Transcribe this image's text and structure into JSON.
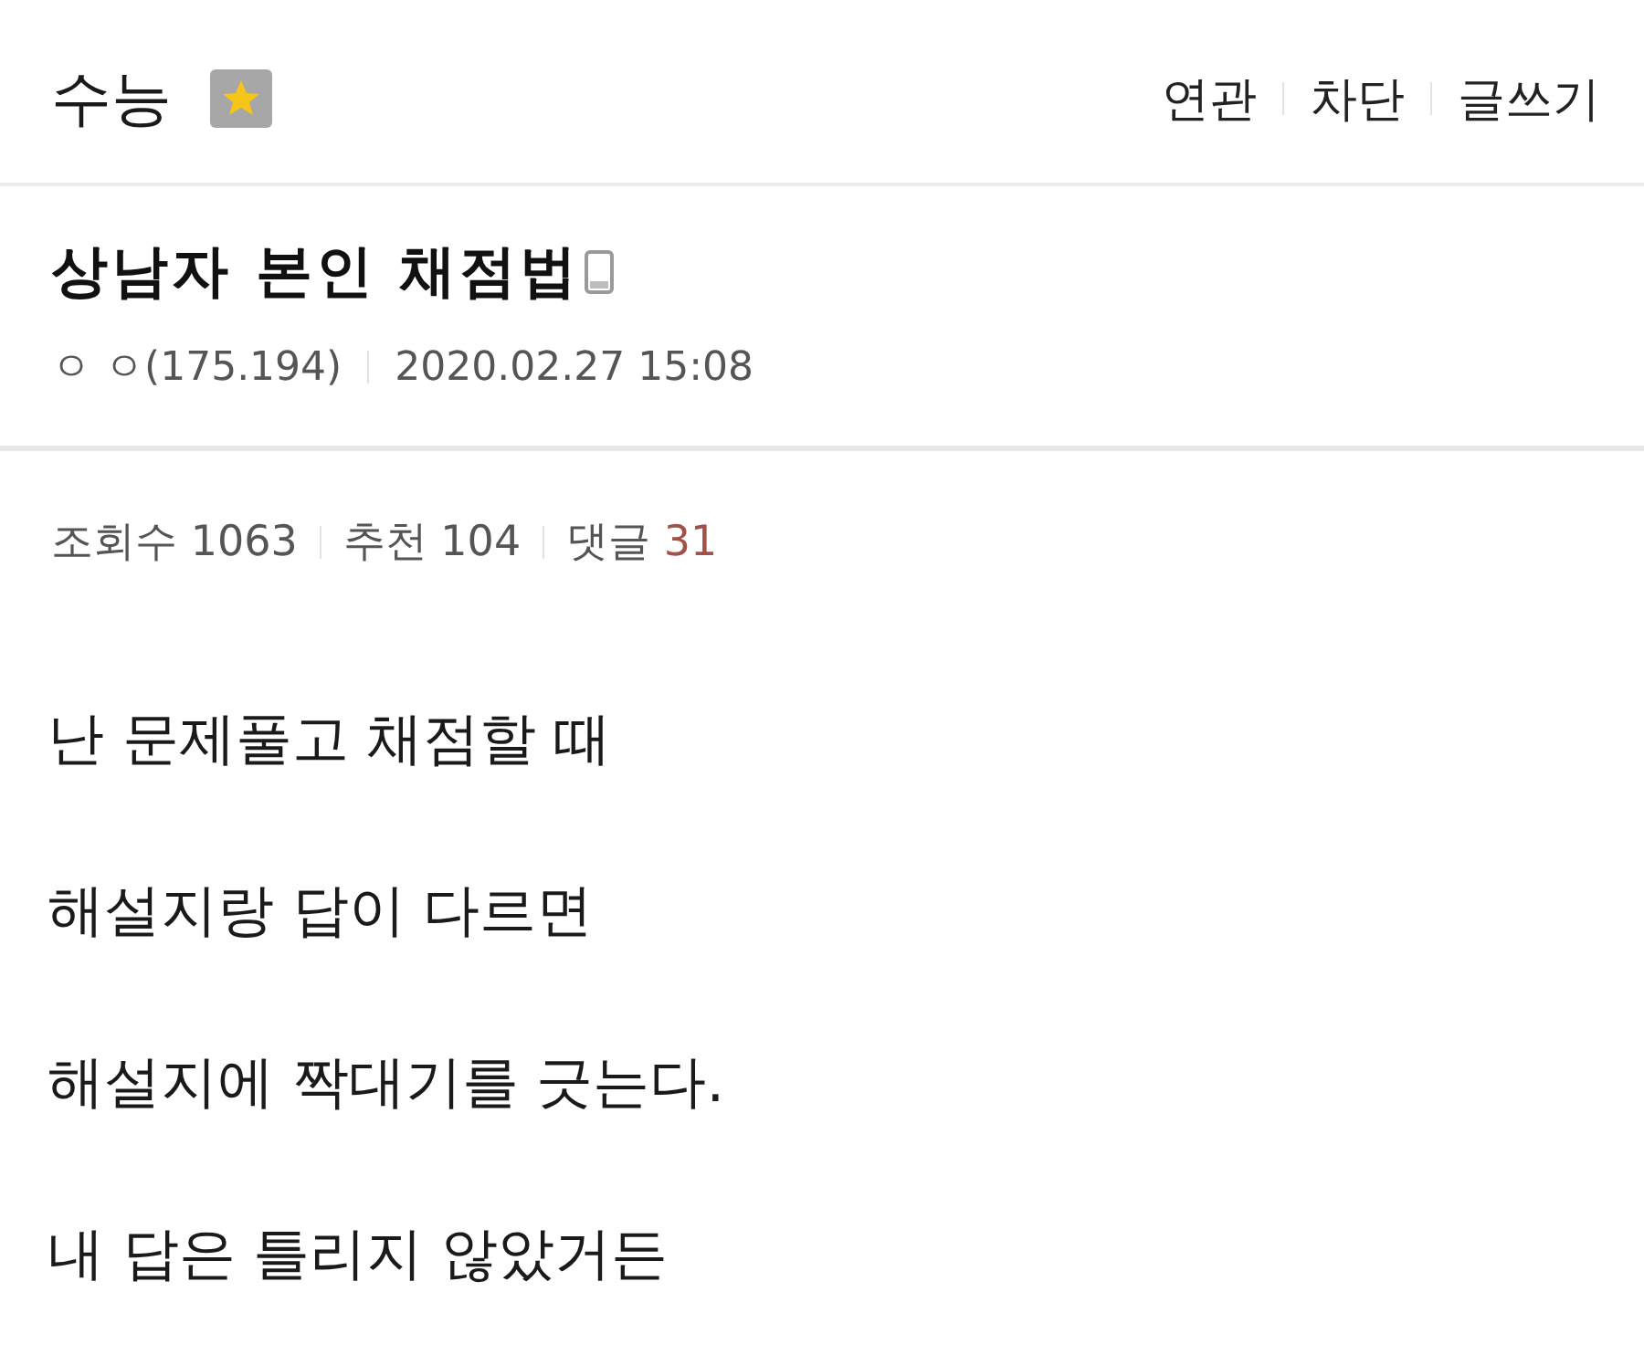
{
  "header": {
    "board_title": "수능",
    "links": [
      "연관",
      "차단",
      "글쓰기"
    ]
  },
  "post": {
    "title": "상남자 본인 채점법",
    "author": "ㅇ ㅇ(175.194)",
    "date": "2020.02.27 15:08"
  },
  "stats": [
    {
      "label": "조회수",
      "value": "1063",
      "highlight": false
    },
    {
      "label": "추천",
      "value": "104",
      "highlight": false
    },
    {
      "label": "댓글",
      "value": "31",
      "highlight": true
    }
  ],
  "body": [
    "난 문제풀고 채점할 때",
    "해설지랑 답이 다르면",
    "해설지에 짝대기를 긋는다.",
    "내 답은 틀리지 않았거든"
  ]
}
